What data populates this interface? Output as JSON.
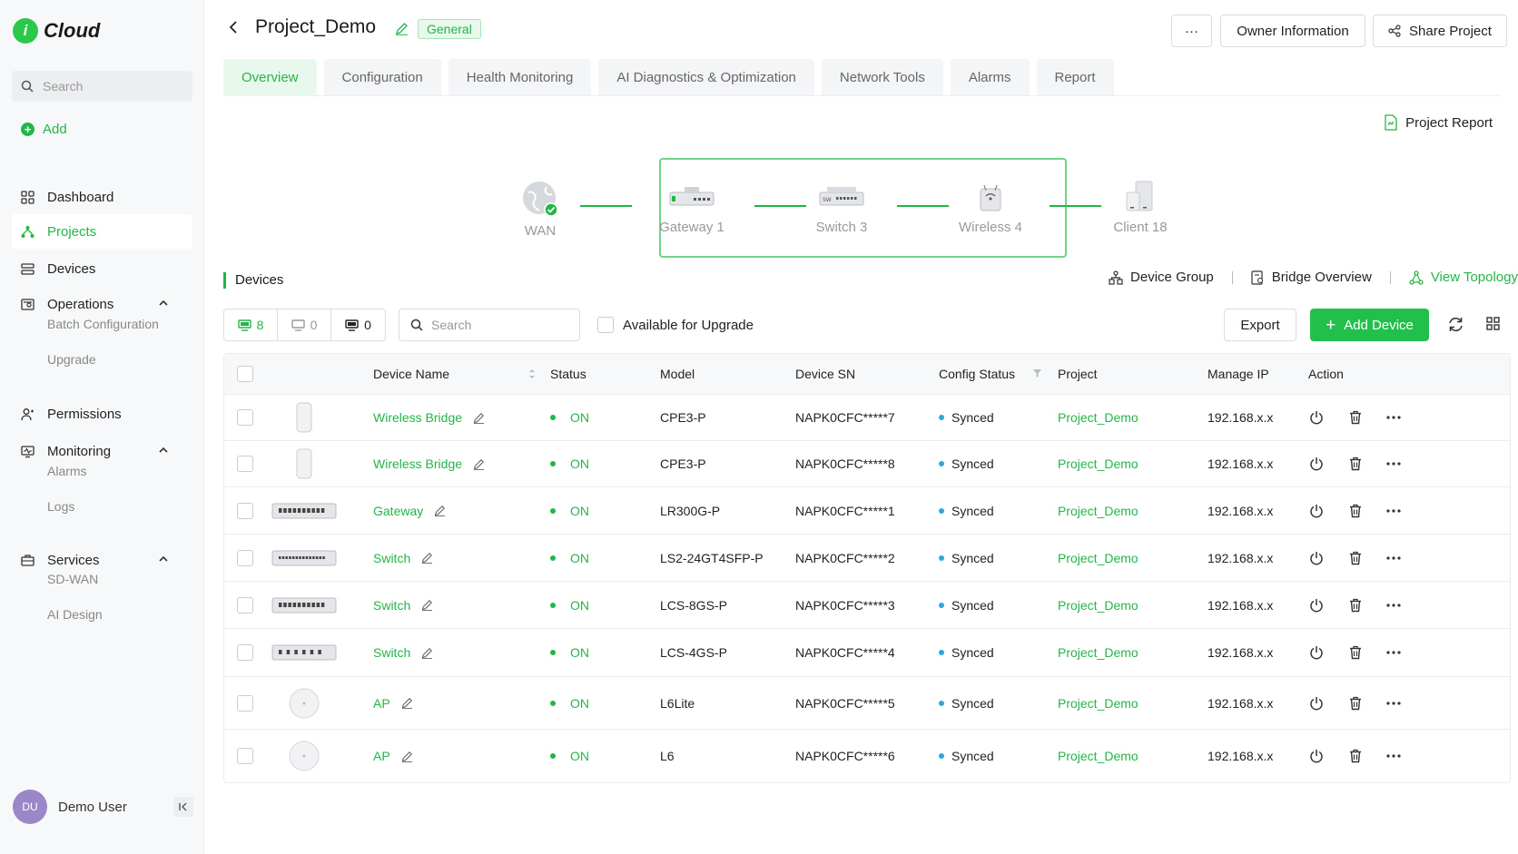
{
  "app": {
    "logo_glyph": "i",
    "name": "Cloud"
  },
  "sidebar": {
    "search_placeholder": "Search",
    "add_label": "Add",
    "nav": {
      "dashboard": "Dashboard",
      "projects": "Projects",
      "devices": "Devices",
      "operations": "Operations",
      "batch_configuration": "Batch Configuration",
      "upgrade": "Upgrade",
      "permissions": "Permissions",
      "monitoring": "Monitoring",
      "alarms": "Alarms",
      "logs": "Logs",
      "services": "Services",
      "sdwan": "SD-WAN",
      "ai_design": "AI Design"
    },
    "user": {
      "initials": "DU",
      "name": "Demo User"
    }
  },
  "header": {
    "title": "Project_Demo",
    "badge": "General",
    "more_label": "···",
    "owner_info": "Owner Information",
    "share_project": "Share Project"
  },
  "tabs": [
    "Overview",
    "Configuration",
    "Health Monitoring",
    "AI Diagnostics & Optimization",
    "Network Tools",
    "Alarms",
    "Report"
  ],
  "project_report": "Project Report",
  "topology": {
    "wan": "WAN",
    "gateway": "Gateway 1",
    "switch": "Switch 3",
    "wireless": "Wireless 4",
    "client": "Client 18"
  },
  "devices": {
    "section_title": "Devices",
    "device_group": "Device Group",
    "bridge_overview": "Bridge Overview",
    "view_topology": "View Topology",
    "count_online": "8",
    "count_offline": "0",
    "count_other": "0",
    "search_placeholder": "Search",
    "available_upgrade": "Available for Upgrade",
    "export": "Export",
    "add_device": "Add Device",
    "columns": {
      "name": "Device Name",
      "status": "Status",
      "model": "Model",
      "sn": "Device SN",
      "config": "Config Status",
      "project": "Project",
      "ip": "Manage IP",
      "action": "Action"
    },
    "rows": [
      {
        "name": "Wireless Bridge",
        "status": "ON",
        "model": "CPE3-P",
        "sn": "NAPK0CFC*****7",
        "config": "Synced",
        "project": "Project_Demo",
        "ip": "192.168.x.x"
      },
      {
        "name": "Wireless Bridge",
        "status": "ON",
        "model": "CPE3-P",
        "sn": "NAPK0CFC*****8",
        "config": "Synced",
        "project": "Project_Demo",
        "ip": "192.168.x.x"
      },
      {
        "name": "Gateway",
        "status": "ON",
        "model": "LR300G-P",
        "sn": "NAPK0CFC*****1",
        "config": "Synced",
        "project": "Project_Demo",
        "ip": "192.168.x.x"
      },
      {
        "name": "Switch",
        "status": "ON",
        "model": "LS2-24GT4SFP-P",
        "sn": "NAPK0CFC*****2",
        "config": "Synced",
        "project": "Project_Demo",
        "ip": "192.168.x.x"
      },
      {
        "name": "Switch",
        "status": "ON",
        "model": "LCS-8GS-P",
        "sn": "NAPK0CFC*****3",
        "config": "Synced",
        "project": "Project_Demo",
        "ip": "192.168.x.x"
      },
      {
        "name": "Switch",
        "status": "ON",
        "model": "LCS-4GS-P",
        "sn": "NAPK0CFC*****4",
        "config": "Synced",
        "project": "Project_Demo",
        "ip": "192.168.x.x"
      },
      {
        "name": "AP",
        "status": "ON",
        "model": "L6Lite",
        "sn": "NAPK0CFC*****5",
        "config": "Synced",
        "project": "Project_Demo",
        "ip": "192.168.x.x"
      },
      {
        "name": "AP",
        "status": "ON",
        "model": "L6",
        "sn": "NAPK0CFC*****6",
        "config": "Synced",
        "project": "Project_Demo",
        "ip": "192.168.x.x"
      }
    ]
  },
  "colors": {
    "accent": "#24b547",
    "synced": "#2ca6e0"
  }
}
